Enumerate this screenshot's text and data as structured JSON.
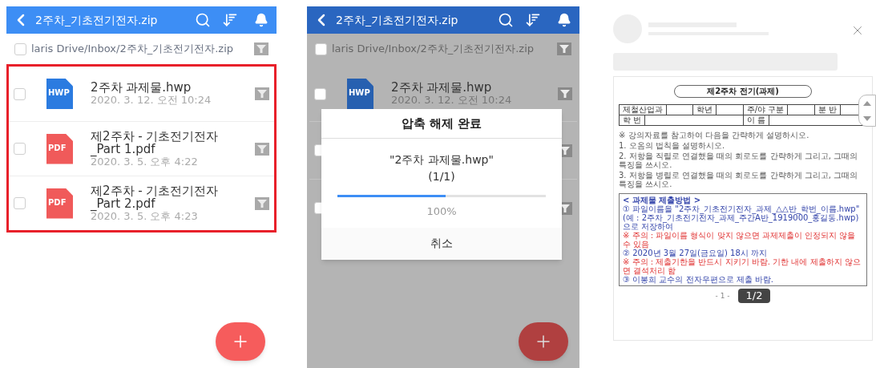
{
  "screens": [
    {
      "kind": "browser",
      "title": "2주차_기초전기전자.zip",
      "path": {
        "text": "laris Drive/Inbox/2주차_기초전기전자.zip",
        "checked": false
      },
      "highlighted": true,
      "files": [
        {
          "kind": "hwp",
          "icon_label": "HWP",
          "name": "2주차 과제물.hwp",
          "date": "2020. 3. 12. 오전 10:24",
          "checked": false
        },
        {
          "kind": "pdf",
          "icon_label": "PDF",
          "name": "제2주차 - 기초전기전자\n_Part 1.pdf",
          "date": "2020. 3. 5. 오후 4:22",
          "checked": false
        },
        {
          "kind": "pdf",
          "icon_label": "PDF",
          "name": "제2주차 - 기초전기전자\n_Part 2.pdf",
          "date": "2020. 3. 5. 오후 4:23",
          "checked": false
        }
      ]
    },
    {
      "kind": "browser",
      "title": "2주차_기초전기전자.zip",
      "path": {
        "text": "laris Drive/Inbox/2주차_기초전기전자.zip",
        "checked": false
      },
      "highlighted": false,
      "files": [
        {
          "kind": "hwp",
          "icon_label": "HWP",
          "name": "2주차 과제물.hwp",
          "date": "2020. 3. 12. 오전 10:24",
          "checked": false
        }
      ],
      "covered_rows": [
        {
          "checked": false
        },
        {
          "checked": false
        }
      ],
      "dialog": {
        "title": "압축 해제 완료",
        "file": "\"2주차 과제물.hwp\"",
        "count": "(1/1)",
        "level": 0.52,
        "percent": "100%",
        "button": "취소"
      }
    },
    {
      "kind": "viewer",
      "page_badge": "1/2",
      "document": {
        "title": "제2주차 전기(과제)",
        "table": [
          {
            "cells": [
              "제철산업과",
              "학년",
              "주/야 구분",
              "분 반"
            ]
          },
          {
            "cells": [
              "학 번",
              "이 름"
            ]
          }
        ],
        "instructions": [
          "※ 강의자료를 참고하여 다음을 간략하게 설명하시오.",
          "1. 오옴의 법칙을 설명하시오.",
          "2. 저항을 직렬로 연결했을 때의 회로도를 간략하게 그리고, 그때의 특징을 쓰시오.",
          "3. 저항을 병렬로 연결했을 때의 회로도를 간략하게 그리고, 그때의 특징을 쓰시오."
        ],
        "submission": {
          "heading": "< 과제물 제출방법 >",
          "lines": [
            {
              "kind": "step",
              "text": "① 파일이름을 \"2주차_기초전기전자_과제_△△반_학번_이름.hwp\""
            },
            {
              "kind": "step",
              "text": "(예 : 2주차_기초전기전자_과제_주간A반_1919000_홍길동.hwp)으로 저장하여"
            },
            {
              "kind": "note",
              "text": "※ 주의 : 파일이름 형식이 맞지 않으면 과제제출이 인정되지 않을 수 있음"
            },
            {
              "kind": "step",
              "text": "② 2020년 3월 27일(금요일) 18시 까지"
            },
            {
              "kind": "note",
              "text": "※ 주의 : 제출기한을 반드시 지키기 바람. 기한 내에 제출하지 않으면 결석처리 함"
            },
            {
              "kind": "step",
              "text": "③ 이봉희 교수의 전자우편으로 제출 바람."
            }
          ]
        },
        "page_number": "- 1 -"
      }
    }
  ]
}
